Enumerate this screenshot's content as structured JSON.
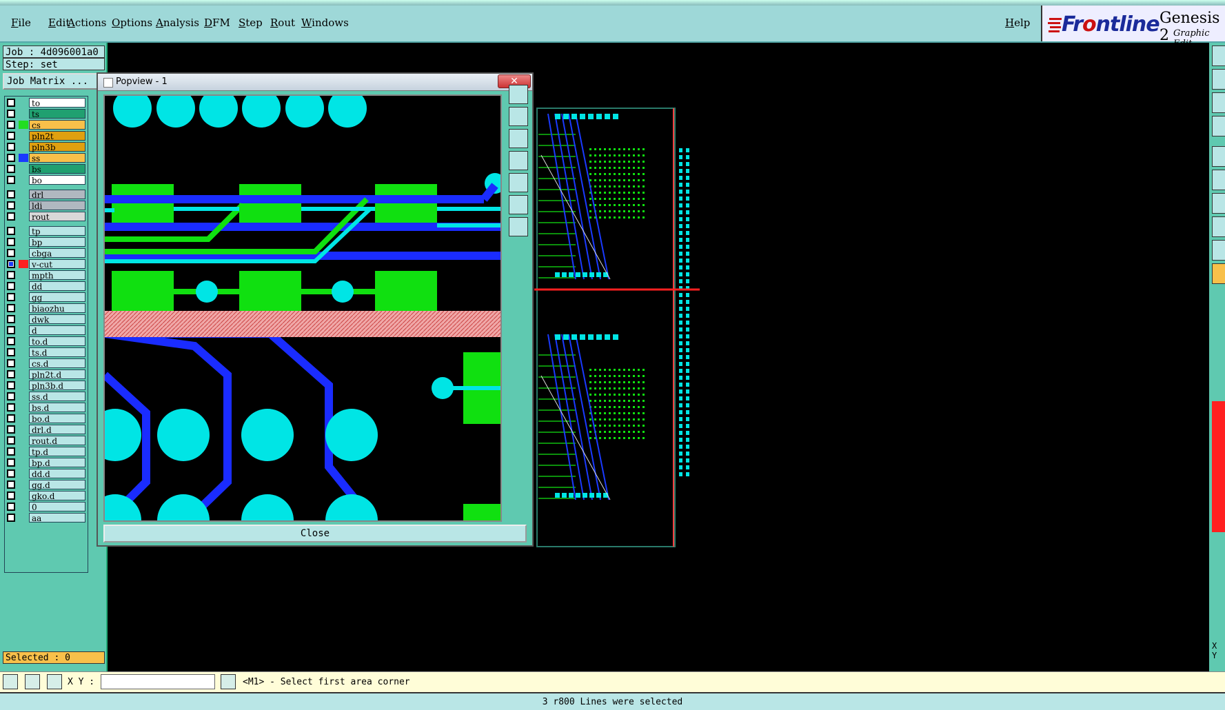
{
  "menu": {
    "items": [
      "File",
      "Edit",
      "Actions",
      "Options",
      "Analysis",
      "DFM",
      "Step",
      "Rout",
      "Windows"
    ],
    "help": "Help"
  },
  "brand": {
    "logo": "Frontline",
    "product": "Genesis 2",
    "subtitle": "Graphic Edit"
  },
  "left_panel": {
    "job": "Job : 4d096001a0",
    "step": "Step: set",
    "job_matrix": "Job Matrix ...",
    "selected": "Selected : 0",
    "layers": [
      {
        "name": "to",
        "bg": "#ffffff",
        "color": ""
      },
      {
        "name": "ts",
        "bg": "#20a070",
        "color": ""
      },
      {
        "name": "cs",
        "bg": "#f8c04a",
        "color": "#22dd22"
      },
      {
        "name": "pln2t",
        "bg": "#e0a010",
        "color": ""
      },
      {
        "name": "pln3b",
        "bg": "#e0a010",
        "color": ""
      },
      {
        "name": "ss",
        "bg": "#f8c04a",
        "color": "#1a3aff"
      },
      {
        "name": "bs",
        "bg": "#20a070",
        "color": ""
      },
      {
        "name": "bo",
        "bg": "#ffffff",
        "color": ""
      },
      {
        "name": "drl",
        "bg": "#b0b8c0",
        "color": ""
      },
      {
        "name": "ldi",
        "bg": "#b0b8c0",
        "color": ""
      },
      {
        "name": "rout",
        "bg": "#d8d8d8",
        "color": ""
      },
      {
        "name": "tp",
        "bg": "#b9e6e6",
        "color": ""
      },
      {
        "name": "bp",
        "bg": "#b9e6e6",
        "color": ""
      },
      {
        "name": "cbga",
        "bg": "#b9e6e6",
        "color": ""
      },
      {
        "name": "v-cut",
        "bg": "#b9e6e6",
        "color": "#ff2020"
      },
      {
        "name": "mpth",
        "bg": "#b9e6e6",
        "color": ""
      },
      {
        "name": "dd",
        "bg": "#b9e6e6",
        "color": ""
      },
      {
        "name": "gg",
        "bg": "#b9e6e6",
        "color": ""
      },
      {
        "name": "biaozhu",
        "bg": "#b9e6e6",
        "color": ""
      },
      {
        "name": "dwk",
        "bg": "#b9e6e6",
        "color": ""
      },
      {
        "name": "d",
        "bg": "#b9e6e6",
        "color": ""
      },
      {
        "name": "to.d",
        "bg": "#b9e6e6",
        "color": ""
      },
      {
        "name": "ts.d",
        "bg": "#b9e6e6",
        "color": ""
      },
      {
        "name": "cs.d",
        "bg": "#b9e6e6",
        "color": ""
      },
      {
        "name": "pln2t.d",
        "bg": "#b9e6e6",
        "color": ""
      },
      {
        "name": "pln3b.d",
        "bg": "#b9e6e6",
        "color": ""
      },
      {
        "name": "ss.d",
        "bg": "#b9e6e6",
        "color": ""
      },
      {
        "name": "bs.d",
        "bg": "#b9e6e6",
        "color": ""
      },
      {
        "name": "bo.d",
        "bg": "#b9e6e6",
        "color": ""
      },
      {
        "name": "drl.d",
        "bg": "#b9e6e6",
        "color": ""
      },
      {
        "name": "rout.d",
        "bg": "#b9e6e6",
        "color": ""
      },
      {
        "name": "tp.d",
        "bg": "#b9e6e6",
        "color": ""
      },
      {
        "name": "bp.d",
        "bg": "#b9e6e6",
        "color": ""
      },
      {
        "name": "dd.d",
        "bg": "#b9e6e6",
        "color": ""
      },
      {
        "name": "gg.d",
        "bg": "#b9e6e6",
        "color": ""
      },
      {
        "name": "gko.d",
        "bg": "#b9e6e6",
        "color": ""
      },
      {
        "name": "0",
        "bg": "#b9e6e6",
        "color": ""
      },
      {
        "name": "aa",
        "bg": "#b9e6e6",
        "color": ""
      }
    ]
  },
  "popview": {
    "title": "Popview - 1",
    "close_x": "✕",
    "close_button": "Close"
  },
  "command_bar": {
    "xy_label": "X Y :",
    "xy_value": "",
    "prompt": "<M1> - Select first area corner"
  },
  "status": "3 r800 Lines were selected",
  "right_toolbar": {
    "xy": "X Y"
  },
  "colors": {
    "panel": "#5fc9b0",
    "menu": "#9ed8d8",
    "copper": "#22dd22",
    "pad": "#00e5e5",
    "trace_blue": "#1a3aff",
    "vcut": "#ff2020"
  }
}
